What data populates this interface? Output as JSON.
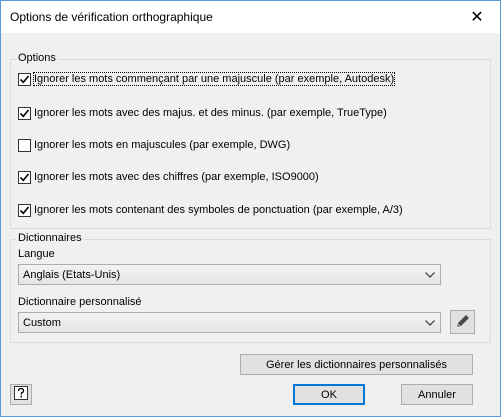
{
  "window": {
    "title": "Options de vérification orthographique",
    "close_glyph": "✕"
  },
  "options": {
    "group_label": "Options",
    "items": [
      {
        "label": "Ignorer les mots commençant par une majuscule (par exemple, Autodesk)",
        "checked": true
      },
      {
        "label": "Ignorer les mots avec des majus. et des minus. (par exemple, TrueType)",
        "checked": true
      },
      {
        "label": "Ignorer les mots en majuscules (par exemple, DWG)",
        "checked": false
      },
      {
        "label": "Ignorer les mots avec des chiffres (par exemple, ISO9000)",
        "checked": true
      },
      {
        "label": "Ignorer les mots contenant des symboles de ponctuation (par exemple, A/3)",
        "checked": true
      }
    ]
  },
  "dictionaries": {
    "group_label": "Dictionnaires",
    "language_label": "Langue",
    "language_value": "Anglais (Etats-Unis)",
    "custom_label": "Dictionnaire personnalisé",
    "custom_value": "Custom",
    "edit_icon": "pencil-icon"
  },
  "buttons": {
    "manage": "Gérer les dictionnaires personnalisés",
    "ok": "OK",
    "cancel": "Annuler",
    "help_icon": "help-icon"
  },
  "colors": {
    "accent": "#0078d7",
    "window_border": "#5b9bd5",
    "background": "#f0f0f0"
  }
}
